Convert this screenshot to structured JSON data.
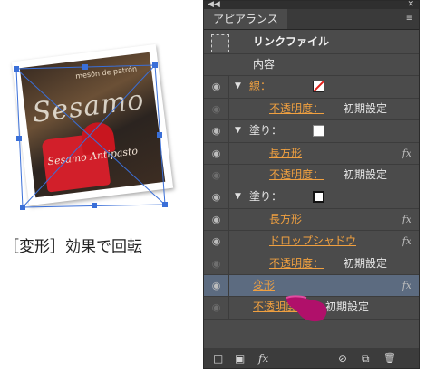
{
  "caption": "［変形］効果で回転",
  "illustration": {
    "photo_small_text": "mesón de patrón",
    "photo_sign_text": "Sesamo",
    "photo_red_text": "Sesamo Antipasto"
  },
  "panel": {
    "title": "アピアランス",
    "collapse_glyph": "◀◀",
    "close_glyph": "✕",
    "menu_glyph": "≡",
    "header_row_label": "リンクファイル",
    "contents_label": "内容",
    "stroke_label": "線：",
    "fill_label": "塗り：",
    "opacity_label": "不透明度：",
    "default_value": "初期設定",
    "rectangle_label": "長方形",
    "drop_shadow_label": "ドロップシャドウ",
    "transform_label": "変形",
    "fx_glyph": "fx",
    "eye_glyph": "◉",
    "expand_glyph": "▼"
  },
  "bottom_icons": [
    "□",
    "▣",
    "fx",
    "⊘",
    "⧉",
    "🗑"
  ],
  "colors": {
    "panel_bg": "#4b4b4b",
    "highlight_row": "#5c6b80",
    "accent_orange": "#f0a040",
    "cursor_magenta": "#b0106a",
    "bbox_blue": "#3a6fd8"
  }
}
